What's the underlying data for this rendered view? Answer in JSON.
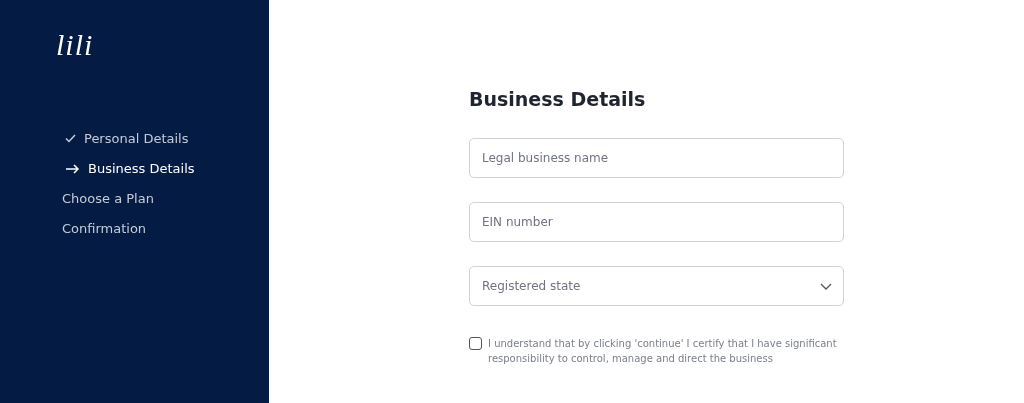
{
  "logo": "lili",
  "steps": [
    {
      "kind": "done",
      "label": "Personal Details",
      "selected": false
    },
    {
      "kind": "current",
      "label": "Business Details",
      "selected": true
    },
    {
      "kind": "pending",
      "label": "Choose a Plan",
      "selected": false
    },
    {
      "kind": "pending",
      "label": "Confirmation",
      "selected": false
    }
  ],
  "title": "Business Details",
  "fields": [
    {
      "kind": "text",
      "placeholder": "Legal business name"
    },
    {
      "kind": "text",
      "placeholder": "EIN number"
    },
    {
      "kind": "select",
      "placeholder": "Registered state"
    }
  ],
  "certify": {
    "checked": false,
    "label": "I understand that by clicking 'continue' I certify that I have significant responsibility to control, manage and direct the business"
  }
}
